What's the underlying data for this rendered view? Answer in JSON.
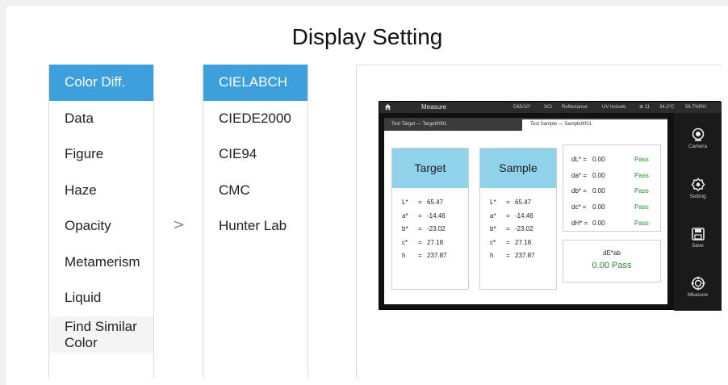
{
  "page": {
    "title": "Display Setting"
  },
  "menu1": {
    "items": [
      {
        "label": "Color Diff.",
        "active": true
      },
      {
        "label": "Data"
      },
      {
        "label": "Figure"
      },
      {
        "label": "Haze"
      },
      {
        "label": "Opacity"
      },
      {
        "label": "Metamerism"
      },
      {
        "label": "Liquid"
      },
      {
        "label": "Find Similar Color"
      }
    ]
  },
  "arrow": ">",
  "menu2": {
    "items": [
      {
        "label": "CIELABCH",
        "active": true
      },
      {
        "label": "CIEDE2000"
      },
      {
        "label": "CIE94"
      },
      {
        "label": "CMC"
      },
      {
        "label": "Hunter Lab"
      }
    ]
  },
  "device": {
    "topbar": {
      "title": "Measure",
      "observer": "D65/10°",
      "mode": "SCI",
      "reflect": "Reflectance",
      "uv": "UV Include",
      "count": "⊕ 11",
      "temp": "34.2°C",
      "humidity": "56.7%RH"
    },
    "tabs": {
      "target": "Test Target — Target0001",
      "sample": "Test Sample — Sample0001"
    },
    "target": {
      "header": "Target",
      "rows": [
        {
          "k": "L*",
          "v": "65.47"
        },
        {
          "k": "a*",
          "v": "-14.46"
        },
        {
          "k": "b*",
          "v": "-23.02"
        },
        {
          "k": "c*",
          "v": "27.18"
        },
        {
          "k": "h",
          "v": "237.87"
        }
      ]
    },
    "sample": {
      "header": "Sample",
      "rows": [
        {
          "k": "L*",
          "v": "65.47"
        },
        {
          "k": "a*",
          "v": "-14.46"
        },
        {
          "k": "b*",
          "v": "-23.02"
        },
        {
          "k": "c*",
          "v": "27.18"
        },
        {
          "k": "h",
          "v": "237.87"
        }
      ]
    },
    "diffs": [
      {
        "k": "dL* =",
        "v": "0.00",
        "s": "Pass"
      },
      {
        "k": "da* =",
        "v": "0.00",
        "s": "Pass"
      },
      {
        "k": "db* =",
        "v": "0.00",
        "s": "Pass"
      },
      {
        "k": "dc* =",
        "v": "0.00",
        "s": "Pass"
      },
      {
        "k": "dH* =",
        "v": "0.00",
        "s": "Pass"
      }
    ],
    "de": {
      "label": "dE*ab",
      "result": "0.00 Pass"
    },
    "side": {
      "camera": "Camera",
      "setting": "Setting",
      "save": "Save",
      "measure": "Measure"
    }
  },
  "colors": {
    "accent": "#3d9fdc",
    "card_header": "#8fd2ea",
    "pass": "#2e8b2e"
  }
}
